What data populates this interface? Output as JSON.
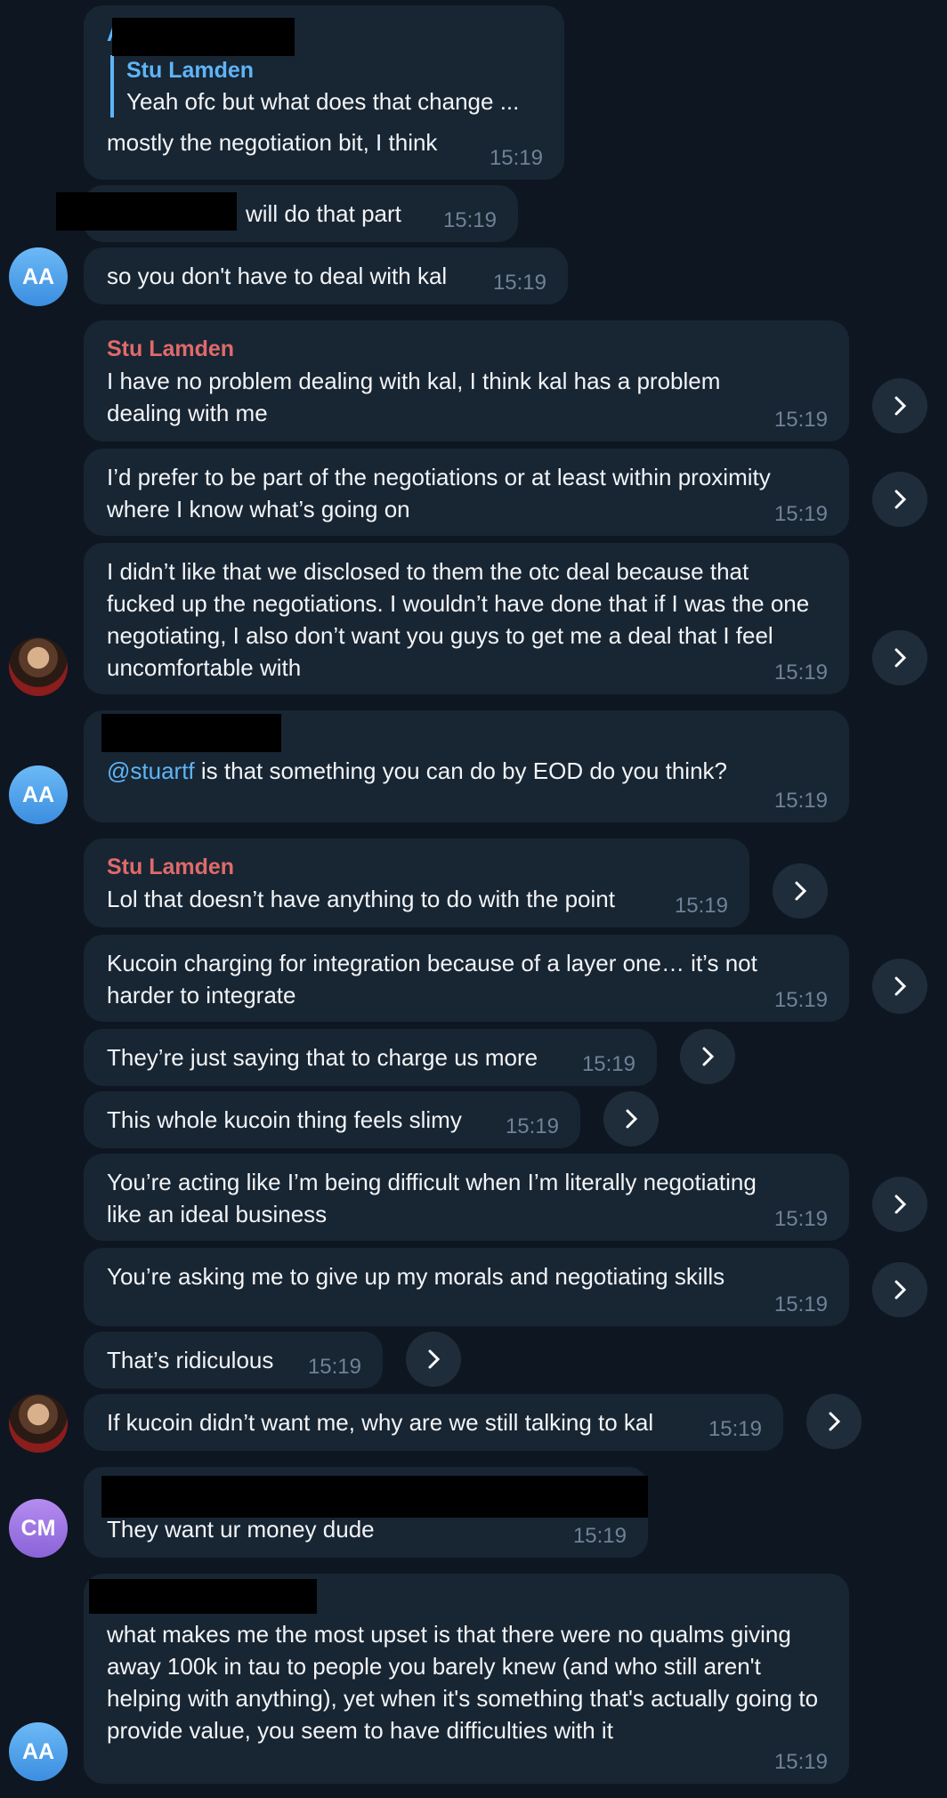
{
  "colors": {
    "background": "#0e1621",
    "bubble": "#182533",
    "accent": "#5eb5f7",
    "sender_red": "#e06a6a",
    "timestamp": "#6f8296"
  },
  "avatars": {
    "aa": "AA",
    "cm": "CM"
  },
  "messages": {
    "m1": {
      "sender_initial": "A",
      "reply_name": "Stu Lamden",
      "reply_text": "Yeah ofc but what does that change ...",
      "text": "mostly the negotiation bit, I think",
      "time": "15:19"
    },
    "m2": {
      "text": "will do that part",
      "time": "15:19"
    },
    "m3": {
      "text": "so you don't have to deal with kal",
      "time": "15:19"
    },
    "m4": {
      "sender": "Stu Lamden",
      "text": "I have no problem dealing with kal, I think kal has a problem dealing with me",
      "time": "15:19"
    },
    "m5": {
      "text": "I’d prefer to be part of the negotiations or at least within proximity where I know what’s going on",
      "time": "15:19"
    },
    "m6": {
      "text": "I didn’t like that we disclosed to them the otc deal because that fucked up the negotiations. I wouldn’t have done that if I was the one negotiating, I also don’t want you guys to get me a deal that I feel uncomfortable with",
      "time": "15:19"
    },
    "m7": {
      "mention": "@stuartf",
      "text": " is that something you can do by EOD do you think?",
      "time": "15:19"
    },
    "m8": {
      "sender": "Stu Lamden",
      "text": "Lol that doesn’t have anything to do with the point",
      "time": "15:19"
    },
    "m9": {
      "text": "Kucoin charging for integration because of a layer one… it’s not harder to integrate",
      "time": "15:19"
    },
    "m10": {
      "text": "They’re just saying that to charge us more",
      "time": "15:19"
    },
    "m11": {
      "text": "This whole kucoin thing feels slimy",
      "time": "15:19"
    },
    "m12": {
      "text": "You’re acting like I’m being difficult when I’m literally negotiating like an ideal business",
      "time": "15:19"
    },
    "m13": {
      "text": "You’re asking me to give up my morals and negotiating skills",
      "time": "15:19"
    },
    "m14": {
      "text": "That’s ridiculous",
      "time": "15:19"
    },
    "m15": {
      "text": "If kucoin didn’t want me, why are we still talking to kal",
      "time": "15:19"
    },
    "m16": {
      "text": "They want ur money dude",
      "time": "15:19"
    },
    "m17": {
      "text": "what makes me the most upset is that there were no qualms giving away 100k in tau to people you barely knew (and who still aren't helping with anything), yet when it's something that's actually going to provide value, you seem to have difficulties with it",
      "time": "15:19"
    }
  }
}
